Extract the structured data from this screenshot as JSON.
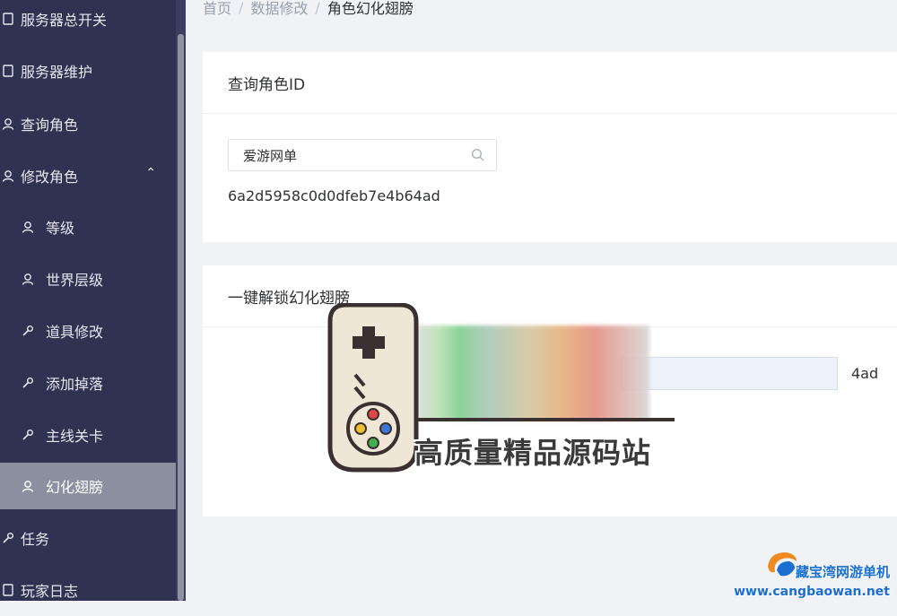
{
  "sidebar": {
    "items": [
      {
        "label": "服务器总开关",
        "icon": "tablet-icon"
      },
      {
        "label": "服务器维护",
        "icon": "tablet-icon"
      },
      {
        "label": "查询角色",
        "icon": "user-icon"
      },
      {
        "label": "修改角色",
        "icon": "user-icon",
        "expanded": true
      },
      {
        "label": "等级",
        "icon": "user-icon"
      },
      {
        "label": "世界层级",
        "icon": "user-icon"
      },
      {
        "label": "道具修改",
        "icon": "wrench-icon"
      },
      {
        "label": "添加掉落",
        "icon": "wrench-icon"
      },
      {
        "label": "主线关卡",
        "icon": "wrench-icon"
      },
      {
        "label": "幻化翅膀",
        "icon": "user-icon",
        "active": true
      },
      {
        "label": "任务",
        "icon": "wrench-icon"
      },
      {
        "label": "玩家日志",
        "icon": "tablet-icon"
      }
    ],
    "expand_arrow": "⌃"
  },
  "breadcrumb": {
    "home": "首页",
    "level2": "数据修改",
    "current": "角色幻化翅膀",
    "separator": "/"
  },
  "query_card": {
    "title": "查询角色ID",
    "search_value": "爱游网单",
    "role_id": "6a2d5958c0d0dfeb7e4b64ad"
  },
  "unlock_card": {
    "title": "一键解锁幻化翅膀",
    "input_value_visible": "4ad"
  },
  "watermark": {
    "text": "高质量精品源码站",
    "corner_name": "藏宝湾网游单机",
    "corner_url": "www.cangbaowan.net"
  },
  "colors": {
    "sidebar_bg": "#2f3251",
    "active_item_bg": "#8c8fa0",
    "page_bg": "#f0f2f5"
  }
}
